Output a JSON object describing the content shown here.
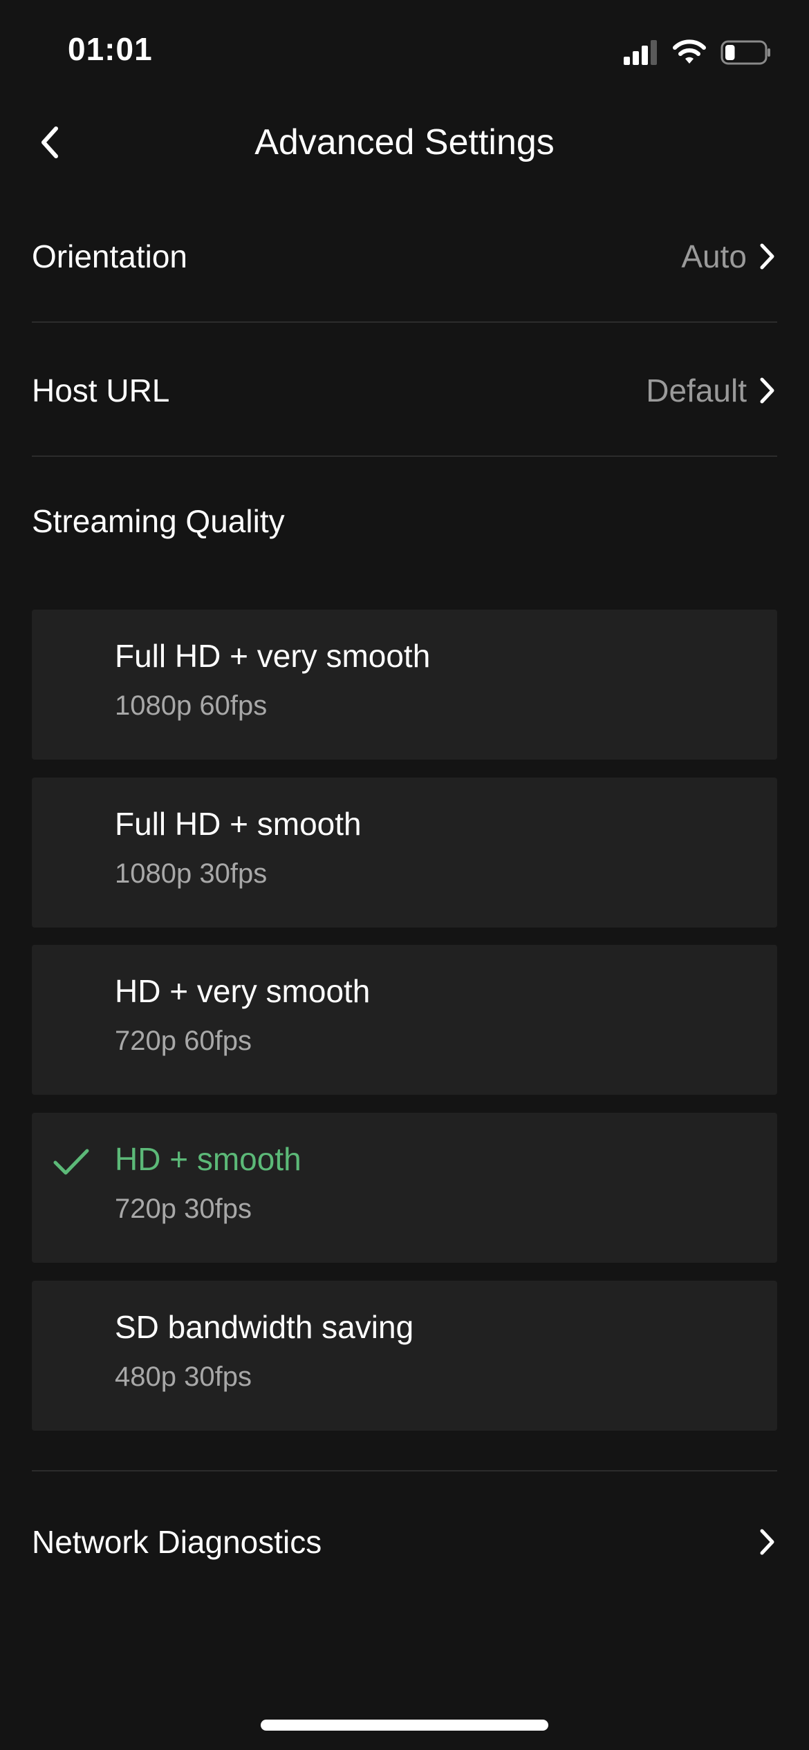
{
  "status_bar": {
    "time": "01:01"
  },
  "nav": {
    "title": "Advanced Settings"
  },
  "settings": {
    "orientation": {
      "label": "Orientation",
      "value": "Auto"
    },
    "host_url": {
      "label": "Host URL",
      "value": "Default"
    },
    "streaming_quality_title": "Streaming Quality",
    "network_diagnostics": {
      "label": "Network Diagnostics"
    }
  },
  "quality_options": [
    {
      "name": "Full HD + very smooth",
      "detail": "1080p 60fps",
      "selected": false
    },
    {
      "name": "Full HD + smooth",
      "detail": "1080p 30fps",
      "selected": false
    },
    {
      "name": "HD + very smooth",
      "detail": "720p 60fps",
      "selected": false
    },
    {
      "name": "HD + smooth",
      "detail": "720p 30fps",
      "selected": true
    },
    {
      "name": "SD bandwidth saving",
      "detail": "480p 30fps",
      "selected": false
    }
  ],
  "colors": {
    "background": "#141414",
    "card": "#212121",
    "accent_selected": "#5cb978",
    "secondary_text": "#9a9a9a"
  },
  "battery_level": 0.25
}
